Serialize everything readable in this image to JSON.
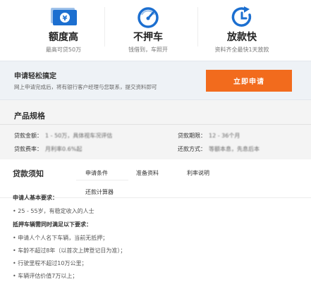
{
  "features": [
    {
      "icon": "money-icon",
      "title": "额度高",
      "subtitle": "最高可贷50万"
    },
    {
      "icon": "speedometer-icon",
      "title": "不押车",
      "subtitle": "钱借到，车照开"
    },
    {
      "icon": "clock-icon",
      "title": "放款快",
      "subtitle": "资料齐全最快1天放款"
    }
  ],
  "colors": {
    "brand_blue": "#1c6fd0",
    "accent_orange": "#f26b1d"
  },
  "apply": {
    "title": "申请轻松搞定",
    "subtitle": "网上申请完成后，将有银行客户经理与您联系，提交资料即可",
    "button_label": "立即申请"
  },
  "spec": {
    "title": "产品规格",
    "rows": [
      [
        {
          "key": "贷款金额：",
          "value": "1 - 50万，具体视车况评估"
        },
        {
          "key": "贷款期限：",
          "value": "12 - 36个月"
        }
      ],
      [
        {
          "key": "贷款费率：",
          "value": "月利率0.6%起"
        },
        {
          "key": "还款方式：",
          "value": "等额本息，先息后本"
        }
      ]
    ]
  },
  "notice": {
    "title": "贷款须知",
    "tabs": [
      "申请条件",
      "准备资料",
      "利率说明",
      "还款计算器"
    ],
    "basic_heading": "申请人基本要求：",
    "basic_items": [
      "• 25 - 55岁，有稳定收入的人士"
    ],
    "car_heading": "抵押车辆需同时满足以下要求：",
    "car_items": [
      "• 申请人个人名下车辆，当前无抵押；",
      "• 车龄不超过8年（以首次上牌登记日为准）；",
      "• 行驶里程不超过10万公里；",
      "• 车辆评估价值7万以上；"
    ]
  }
}
